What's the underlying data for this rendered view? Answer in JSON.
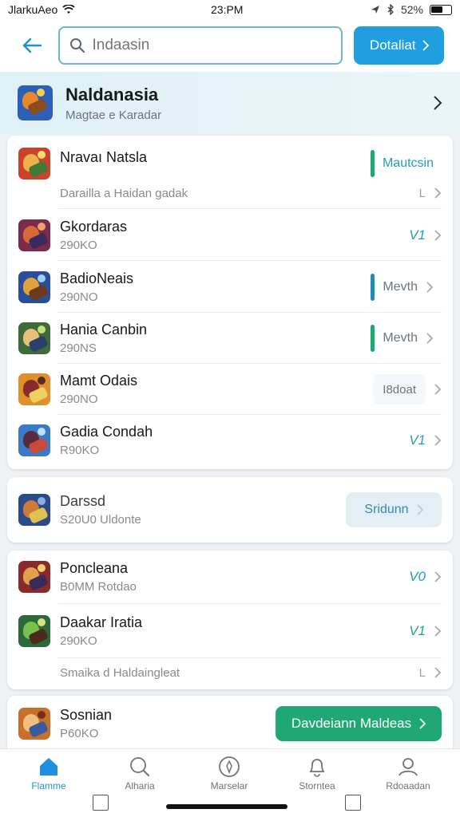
{
  "status": {
    "carrier": "JlarkuАeo",
    "time": "23:PM",
    "battery": "52%"
  },
  "header": {
    "search_placeholder": "Indaasin",
    "action_label": "Dotaliat"
  },
  "hero": {
    "title": "Naldanasia",
    "subtitle": "Magtae e Karadar"
  },
  "group1": {
    "rows": [
      {
        "title": "Nravaı Natsla",
        "status": "Mautcsin"
      },
      {
        "title": "Darailla a Haidan gadak"
      },
      {
        "title": "Gkordaras",
        "subtitle": "290KO",
        "version": "V1"
      },
      {
        "title": "BadioNeais",
        "subtitle": "290NO",
        "status": "Mеvth"
      },
      {
        "title": "Hania Canbin",
        "subtitle": "290NS",
        "status": "Mеvth"
      },
      {
        "title": "Mamt Odais",
        "subtitle": "290NO",
        "action": "I8doat"
      },
      {
        "title": "Gadia Condah",
        "subtitle": "R90KO",
        "version": "V1"
      }
    ]
  },
  "group2": {
    "title": "Darssd",
    "subtitle": "S20U0 Uldonte",
    "action": "Sridunn"
  },
  "group3": {
    "rows": [
      {
        "title": "Poncleana",
        "subtitle": "B0MM Rotdao",
        "version": "V0"
      },
      {
        "title": "Daakar Iratia",
        "subtitle": "290KO",
        "version": "V1"
      },
      {
        "title": "Smaika d Haldaingleat"
      }
    ]
  },
  "group4": {
    "title": "Sosnian",
    "subtitle": "P60KO",
    "action": "Davdeiann Maldeas"
  },
  "tabs": [
    {
      "label": "Flamme"
    },
    {
      "label": "Alharia"
    },
    {
      "label": "Marselar"
    },
    {
      "label": "Storntea"
    },
    {
      "label": "Rdoaadan"
    }
  ],
  "colors": {
    "accent": "#1f9fe0",
    "green": "#1fa874",
    "teal": "#239fb8"
  }
}
